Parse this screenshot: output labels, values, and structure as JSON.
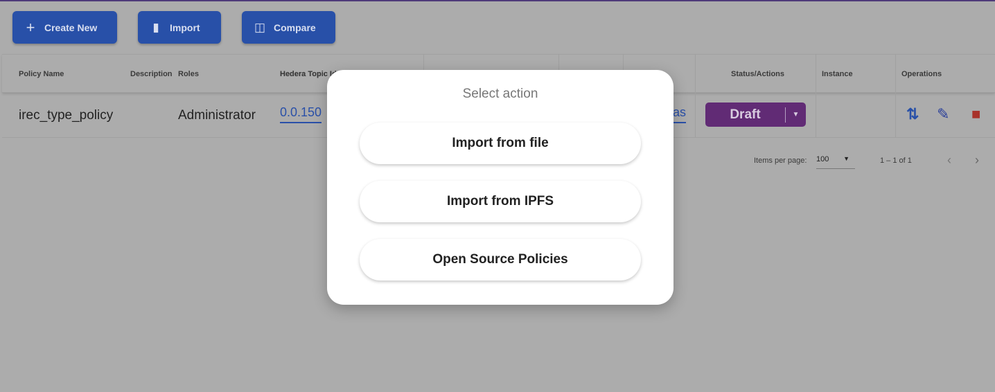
{
  "toolbar": {
    "create_new": "Create New",
    "import": "Import",
    "compare": "Compare"
  },
  "table": {
    "headers": [
      "Policy Name",
      "Description",
      "Roles",
      "Hedera Topic Id",
      "Status/Actions",
      "Instance",
      "Operations"
    ],
    "header_visible": {
      "topic": "Hedera Topic I"
    },
    "rows": [
      {
        "policy_name": "irec_type_policy",
        "roles": "Administrator",
        "topic_id_partial": "0.0.150",
        "schemas_partial": "as",
        "status": "Draft"
      }
    ]
  },
  "pagination": {
    "items_per_page_label": "Items per page:",
    "items_per_page": "100",
    "range": "1 – 1 of 1"
  },
  "modal": {
    "title": "Select action",
    "options": [
      "Import from file",
      "Import from IPFS",
      "Open Source Policies"
    ]
  },
  "colors": {
    "primary": "#2850a8",
    "draft": "#612b75",
    "delete": "#a8322a"
  }
}
